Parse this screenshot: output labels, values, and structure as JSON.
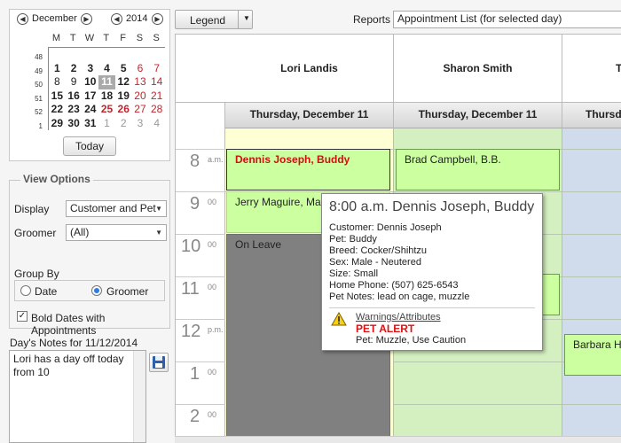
{
  "calendar": {
    "month": "December",
    "year": "2014",
    "weekdays": [
      "M",
      "T",
      "W",
      "T",
      "F",
      "S",
      "S"
    ],
    "weeks": [
      "48",
      "49",
      "50",
      "51",
      "52",
      "1"
    ],
    "rows": [
      [
        "",
        "",
        "",
        "",
        "",
        "",
        ""
      ],
      [
        "1",
        "2",
        "3",
        "4",
        "5",
        "6",
        "7"
      ],
      [
        "8",
        "9",
        "10",
        "11",
        "12",
        "13",
        "14"
      ],
      [
        "15",
        "16",
        "17",
        "18",
        "19",
        "20",
        "21"
      ],
      [
        "22",
        "23",
        "24",
        "25",
        "26",
        "27",
        "28"
      ],
      [
        "29",
        "30",
        "31",
        "1",
        "2",
        "3",
        "4"
      ]
    ],
    "today_label": "Today"
  },
  "view_options": {
    "title": "View Options",
    "display_label": "Display",
    "display_value": "Customer and Pet",
    "groomer_label": "Groomer",
    "groomer_value": "(All)",
    "groupby_label": "Group By",
    "groupby_date": "Date",
    "groupby_groomer": "Groomer",
    "bold_dates_label": "Bold Dates with Appointments"
  },
  "notes": {
    "label": "Day's Notes for 11/12/2014",
    "text": "Lori has a day off today from 10"
  },
  "toolbar": {
    "legend_label": "Legend",
    "reports_label": "Reports",
    "reports_value": "Appointment List (for selected day)"
  },
  "scheduler": {
    "groomers": [
      "Lori Landis",
      "Sharon Smith",
      "T"
    ],
    "day_labels": [
      "Thursday, December 11",
      "Thursday, December 11",
      "Thursd"
    ],
    "hours": [
      {
        "h": "8",
        "m": "a.m."
      },
      {
        "h": "9",
        "m": "00"
      },
      {
        "h": "10",
        "m": "00"
      },
      {
        "h": "11",
        "m": "00"
      },
      {
        "h": "12",
        "m": "p.m."
      },
      {
        "h": "1",
        "m": "00"
      },
      {
        "h": "2",
        "m": "00"
      }
    ],
    "appointments": {
      "lori_1": "Dennis Joseph, Buddy",
      "lori_2": "Jerry Maguire, Mand",
      "lori_leave": "On Leave",
      "sharon_1": "Brad Campbell, B.B.",
      "t_1": "Barbara Ho"
    }
  },
  "tooltip": {
    "title": "8:00 a.m. Dennis Joseph, Buddy",
    "lines": [
      "Customer: Dennis Joseph",
      "Pet: Buddy",
      "Breed: Cocker/Shihtzu",
      "Sex: Male - Neutered",
      "Size: Small",
      "Home Phone: (507) 625-6543",
      "Pet Notes: lead on cage, muzzle"
    ],
    "warnings_label": "Warnings/Attributes",
    "alert_label": "PET ALERT",
    "alert_detail": "Pet: Muzzle, Use Caution"
  },
  "colors": {
    "appt_green": "#ccffa0",
    "leave_gray": "#808080",
    "alert_red": "#e01010",
    "lori_bg": "#ffffd6",
    "sharon_bg": "#d4efc0",
    "t_bg": "#d0dceb"
  }
}
